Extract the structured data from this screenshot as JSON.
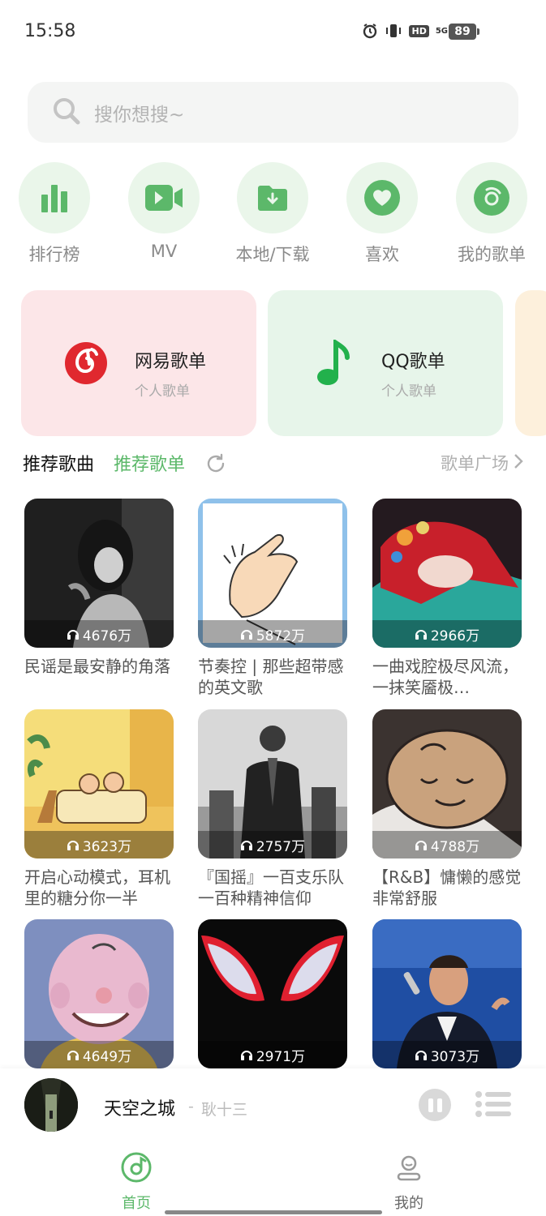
{
  "status_bar": {
    "time": "15:58",
    "network": "5G",
    "hd": "HD",
    "battery": "89"
  },
  "search": {
    "placeholder": "搜你想搜~"
  },
  "entries": [
    {
      "label": "排行榜",
      "icon": "bar-chart-icon"
    },
    {
      "label": "MV",
      "icon": "video-camera-icon"
    },
    {
      "label": "本地/下载",
      "icon": "download-folder-icon"
    },
    {
      "label": "喜欢",
      "icon": "heart-icon"
    },
    {
      "label": "我的歌单",
      "icon": "my-playlist-icon"
    }
  ],
  "sources": [
    {
      "title": "网易歌单",
      "subtitle": "个人歌单",
      "color": "#e0282f"
    },
    {
      "title": "QQ歌单",
      "subtitle": "个人歌单",
      "color": "#22b14c"
    }
  ],
  "section": {
    "tab_songs": "推荐歌曲",
    "tab_playlists": "推荐歌单",
    "plaza": "歌单广场"
  },
  "playlists": [
    {
      "count": "4676万",
      "title": "民谣是最安静的角落"
    },
    {
      "count": "5872万",
      "title": "节奏控 | 那些超带感的英文歌"
    },
    {
      "count": "2966万",
      "title": "一曲戏腔极尽风流，一抹笑靥极…"
    },
    {
      "count": "3623万",
      "title": "开启心动模式，耳机里的糖分你一半"
    },
    {
      "count": "2757万",
      "title": "『国摇』一百支乐队一百种精神信仰"
    },
    {
      "count": "4788万",
      "title": "【R&B】慵懒的感觉非常舒服"
    },
    {
      "count": "4649万",
      "title": ""
    },
    {
      "count": "2971万",
      "title": ""
    },
    {
      "count": "3073万",
      "title": ""
    }
  ],
  "player": {
    "song": "天空之城",
    "separator": "-",
    "artist": "耿十三"
  },
  "nav": [
    {
      "label": "首页",
      "active": true
    },
    {
      "label": "我的",
      "active": false
    }
  ],
  "colors": {
    "accent": "#5cb86a",
    "entry_bg": "#eaf6ea",
    "netease": "#fce6e8",
    "qq": "#e7f5ea"
  }
}
